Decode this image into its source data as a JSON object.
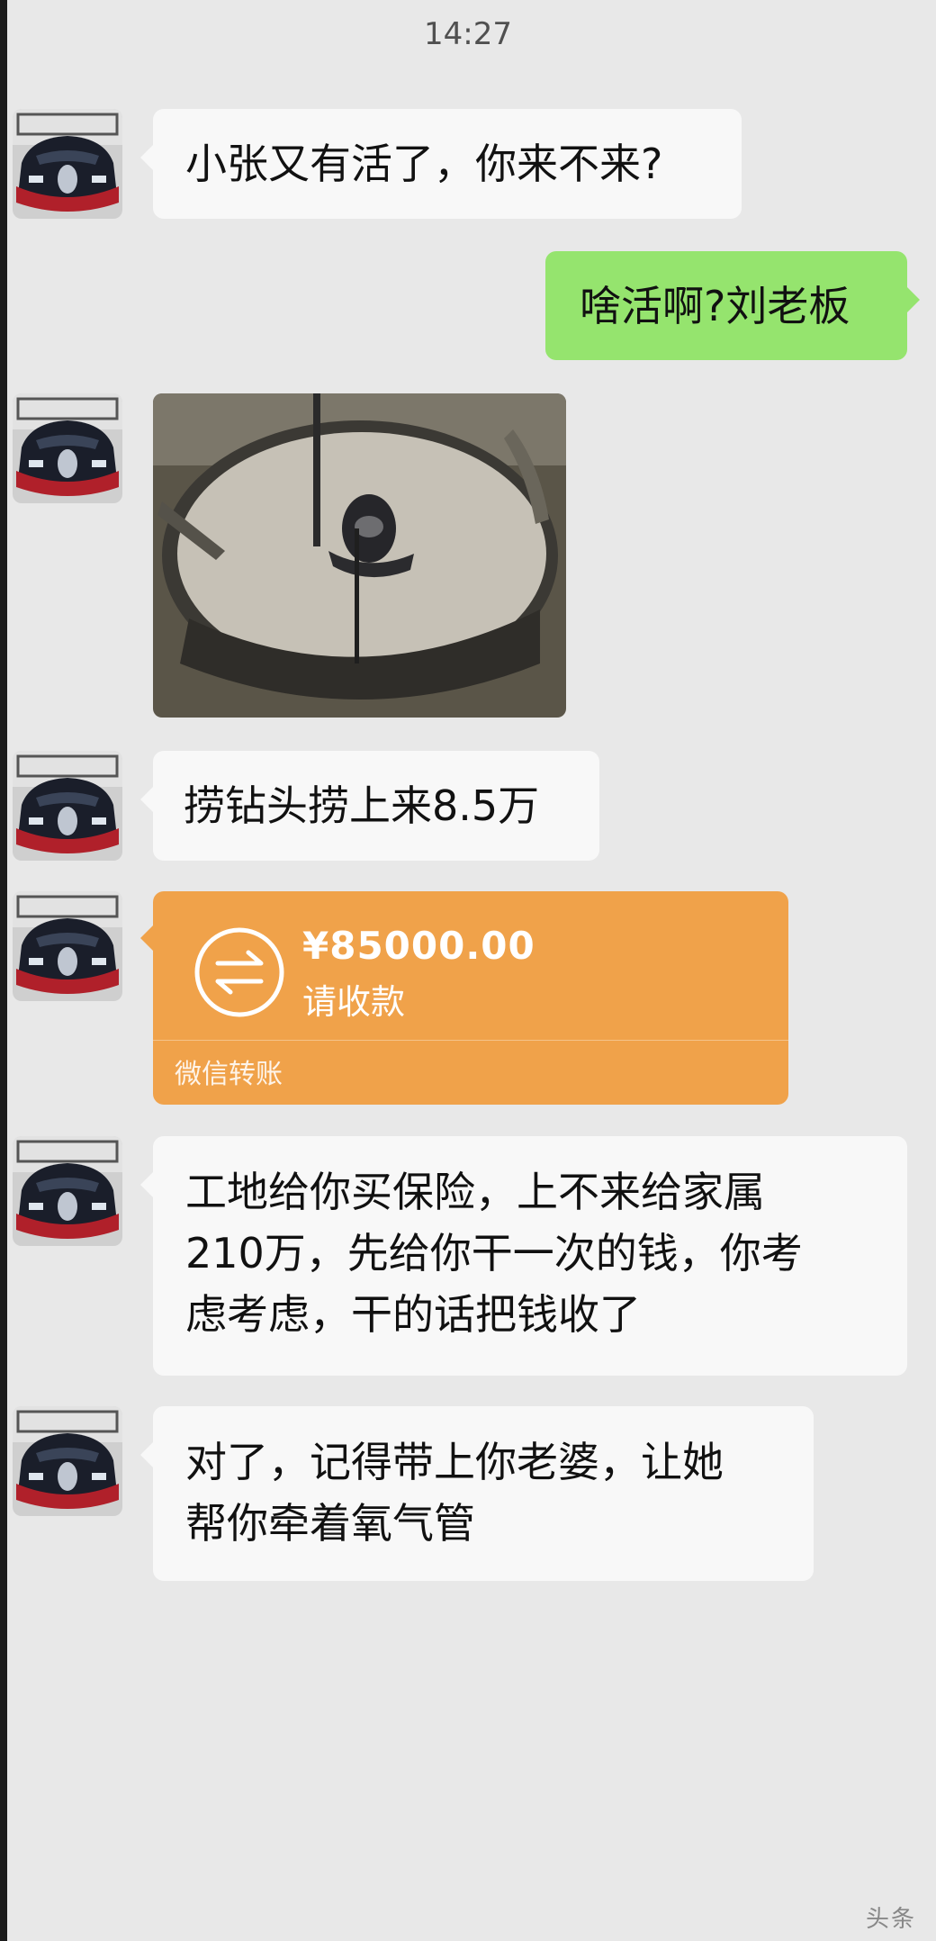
{
  "status_time": "14:27",
  "messages": {
    "m1": "小张又有活了，你来不来?",
    "m2": "啥活啊?刘老板",
    "m4": "捞钻头捞上来8.5万",
    "m6": [
      "工地给你买保险，上不来给家属",
      "210万，先给你干一次的钱，你考",
      "虑考虑，干的话把钱收了"
    ],
    "m7": [
      "对了，记得带上你老婆，让她",
      "帮你牵着氧气管"
    ]
  },
  "transfer": {
    "amount": "¥85000.00",
    "status": "请收款",
    "footer": "微信转账",
    "color": "#f0a24a",
    "icon": "transfer-arrows-icon"
  },
  "watermark": "头条",
  "colors": {
    "background": "#e8e8e8",
    "incoming_bubble": "#f8f8f8",
    "outgoing_bubble": "#95e46e"
  }
}
